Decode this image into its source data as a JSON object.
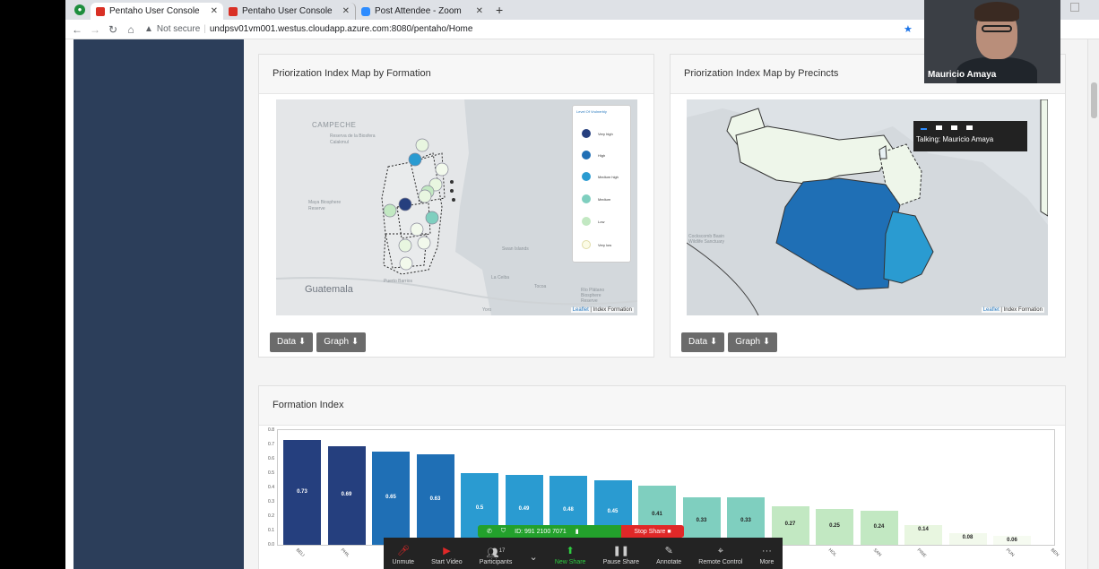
{
  "browser": {
    "tabs": [
      {
        "label": "Pentaho User Console",
        "icon": "pentaho-icon",
        "active": true
      },
      {
        "label": "Pentaho User Console",
        "icon": "pentaho-icon",
        "active": false
      },
      {
        "label": "Post Attendee - Zoom",
        "icon": "zoom-icon",
        "active": false
      }
    ],
    "security_label": "Not secure",
    "url": "undpsv01vm001.westus.cloudapp.azure.com:8080/pentaho/Home"
  },
  "panels": {
    "formation_map": {
      "title": "Priorization Index Map by Formation",
      "labels": [
        "CAMPECHE",
        "Reserva de la Biosfera Calakmul",
        "Maya Biosphere Reserve",
        "Guatemala",
        "Puerto Barrios",
        "La Ceiba",
        "Tocoa",
        "Río Plátano Biosphere Reserve",
        "Yoro",
        "Swan Islands"
      ],
      "legend_title": "Level Of Vrulnerbly",
      "legend": [
        {
          "label": "Very high",
          "color": "#253f7e"
        },
        {
          "label": "High",
          "color": "#1f6fb5"
        },
        {
          "label": "Medium high",
          "color": "#2a9bd1"
        },
        {
          "label": "Medium",
          "color": "#7fcfbf"
        },
        {
          "label": "Low",
          "color": "#c2e8c2"
        },
        {
          "label": "Very low",
          "color": "#fbfbe6"
        }
      ],
      "attribution_link": "Leaflet",
      "attribution_text": "| Index Formation"
    },
    "precincts_map": {
      "title": "Priorization Index Map by Precincts",
      "labels": [
        "Cockscomb Basin Wildlife Sanctuary"
      ],
      "attribution_link": "Leaflet",
      "attribution_text": "| Index Formation"
    },
    "buttons": {
      "data": "Data ⬇",
      "graph": "Graph ⬇"
    },
    "formation_index": {
      "title": "Formation Index"
    }
  },
  "chart_data": {
    "type": "bar",
    "title": "Formation Index",
    "ylim": [
      0,
      0.8
    ],
    "yticks": [
      "0.0",
      "0.1",
      "0.2",
      "0.3",
      "0.4",
      "0.5",
      "0.6",
      "0.7",
      "0.8"
    ],
    "categories": [
      "BELI",
      "PHIL",
      "",
      "",
      "",
      "",
      "",
      "",
      "",
      "",
      "",
      "",
      "HOL",
      "SAN",
      "PINE",
      "",
      "PUN",
      "BEN",
      "CAY"
    ],
    "values": [
      0.73,
      0.69,
      0.65,
      0.63,
      0.5,
      0.49,
      0.48,
      0.45,
      0.41,
      0.33,
      0.33,
      0.27,
      0.25,
      0.24,
      0.14,
      0.08,
      0.06
    ],
    "bar_colors": [
      "#253f7e",
      "#253f7e",
      "#1f6fb5",
      "#1f6fb5",
      "#2a9bd1",
      "#2a9bd1",
      "#2a9bd1",
      "#2a9bd1",
      "#7fcfbf",
      "#7fcfbf",
      "#7fcfbf",
      "#c2e8c2",
      "#c2e8c2",
      "#c2e8c2",
      "#e8f6e0",
      "#f2f9ec",
      "#f6fbf1"
    ],
    "data_labels": [
      "0.73",
      "0.69",
      "0.65",
      "0.63",
      "0.5",
      "0.49",
      "0.48",
      "0.45",
      "0.41",
      "0.33",
      "0.33",
      "0.27",
      "0.25",
      "0.24",
      "0.14",
      "0.08",
      "0.06"
    ]
  },
  "zoom": {
    "participant_name": "Mauricio Amaya",
    "talking": "Talking: Mauricio Amaya",
    "meeting_id": "ID: 991 2100 7071",
    "stop_share": "Stop Share",
    "participants_count": "17",
    "controls": [
      {
        "label": "Unmute",
        "icon": "mic-muted-icon"
      },
      {
        "label": "Start Video",
        "icon": "video-off-icon"
      },
      {
        "label": "Participants",
        "icon": "participants-icon"
      },
      {
        "label": "New Share",
        "icon": "share-icon"
      },
      {
        "label": "Pause Share",
        "icon": "pause-icon"
      },
      {
        "label": "Annotate",
        "icon": "pen-icon"
      },
      {
        "label": "Remote Control",
        "icon": "mouse-icon"
      },
      {
        "label": "More",
        "icon": "more-icon"
      }
    ]
  }
}
